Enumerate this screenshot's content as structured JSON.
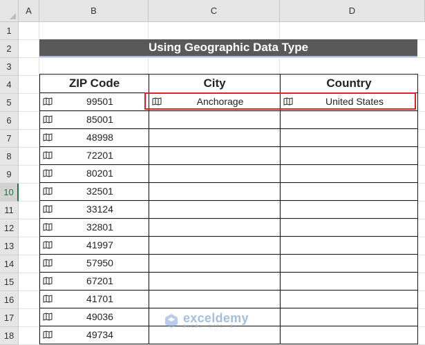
{
  "columns": [
    "A",
    "B",
    "C",
    "D"
  ],
  "rows": [
    "1",
    "2",
    "3",
    "4",
    "5",
    "6",
    "7",
    "8",
    "9",
    "10",
    "11",
    "12",
    "13",
    "14",
    "15",
    "16",
    "17",
    "18"
  ],
  "active_row": "10",
  "title": "Using Geographic Data Type",
  "headers": [
    "ZIP Code",
    "City",
    "Country"
  ],
  "records": [
    {
      "zip": "99501",
      "city": "Anchorage",
      "country": "United States"
    },
    {
      "zip": "85001",
      "city": "",
      "country": ""
    },
    {
      "zip": "48998",
      "city": "",
      "country": ""
    },
    {
      "zip": "72201",
      "city": "",
      "country": ""
    },
    {
      "zip": "80201",
      "city": "",
      "country": ""
    },
    {
      "zip": "32501",
      "city": "",
      "country": ""
    },
    {
      "zip": "33124",
      "city": "",
      "country": ""
    },
    {
      "zip": "32801",
      "city": "",
      "country": ""
    },
    {
      "zip": "41997",
      "city": "",
      "country": ""
    },
    {
      "zip": "57950",
      "city": "",
      "country": ""
    },
    {
      "zip": "67201",
      "city": "",
      "country": ""
    },
    {
      "zip": "41701",
      "city": "",
      "country": ""
    },
    {
      "zip": "49036",
      "city": "",
      "country": ""
    },
    {
      "zip": "49734",
      "city": "",
      "country": ""
    }
  ],
  "geo_icon": "map-icon",
  "watermark": {
    "name": "exceldemy",
    "tagline": "EXCEL · DATA · BI"
  },
  "colors": {
    "title_bg": "#595959",
    "highlight": "#e02020",
    "active_header": "#217346"
  }
}
